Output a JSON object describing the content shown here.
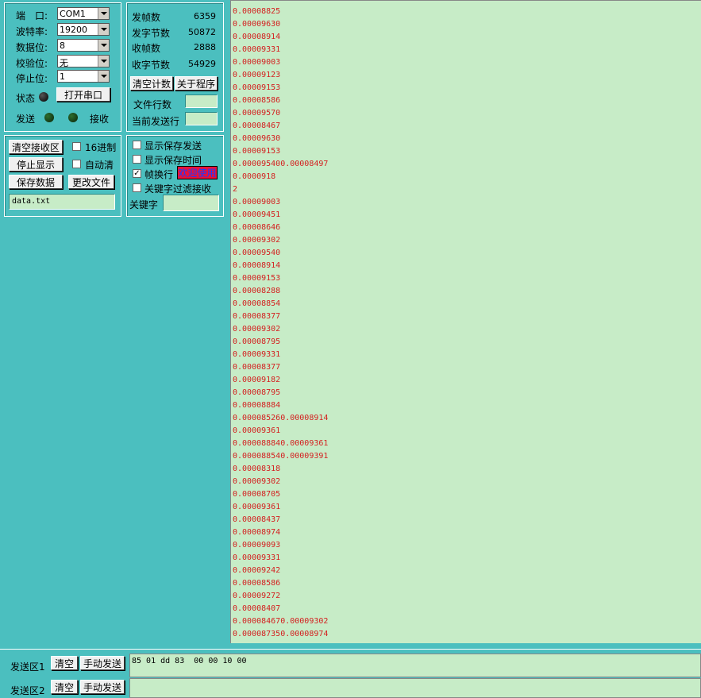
{
  "port_panel": {
    "port_label": "端　口:",
    "port_value": "COM1",
    "baud_label": "波特率:",
    "baud_value": "19200",
    "databits_label": "数据位:",
    "databits_value": "8",
    "parity_label": "校验位:",
    "parity_value": "无",
    "stopbits_label": "停止位:",
    "stopbits_value": "1",
    "status_label": "状态",
    "open_button": "打开串口",
    "send_label": "发送",
    "recv_label": "接收"
  },
  "stats_panel": {
    "sent_frames_label": "发帧数",
    "sent_frames": "6359",
    "sent_bytes_label": "发字节数",
    "sent_bytes": "50872",
    "recv_frames_label": "收帧数",
    "recv_frames": "2888",
    "recv_bytes_label": "收字节数",
    "recv_bytes": "54929",
    "clear_count_button": "清空计数",
    "about_button": "关于程序",
    "file_lines_label": "文件行数",
    "current_line_label": "当前发送行"
  },
  "recv_controls": {
    "clear_recv_button": "清空接收区",
    "hex_label": "16进制",
    "stop_display_button": "停止显示",
    "auto_clear_label": "自动清",
    "save_data_button": "保存数据",
    "change_file_button": "更改文件",
    "filename": "data.txt"
  },
  "options_panel": {
    "show_saved_send_label": "显示保存发送",
    "show_saved_time_label": "显示保存时间",
    "frame_newline_label": "帧换行",
    "frame_newline_checked": "✓",
    "welcome_label": "欢迎使用",
    "keyword_filter_label": "关键字过滤接收",
    "keyword_label": "关键字"
  },
  "recv_lines": [
    "0.00008825",
    "0.00009630",
    "0.00008914",
    "0.00009331",
    "0.00009003",
    "0.00009123",
    "0.00009153",
    "0.00008586",
    "0.00009570",
    "0.00008467",
    "0.00009630",
    "0.00009153",
    "0.000095400.00008497",
    "0.0000918",
    "2",
    "0.00009003",
    "0.00009451",
    "0.00008646",
    "0.00009302",
    "0.00009540",
    "0.00008914",
    "0.00009153",
    "0.00008288",
    "0.00008854",
    "0.00008377",
    "0.00009302",
    "0.00008795",
    "0.00009331",
    "0.00008377",
    "0.00009182",
    "0.00008795",
    "0.00008884",
    "0.000085260.00008914",
    "0.00009361",
    "0.000088840.00009361",
    "0.000088540.00009391",
    "0.00008318",
    "0.00009302",
    "0.00008705",
    "0.00009361",
    "0.00008437",
    "0.00008974",
    "0.00009093",
    "0.00009331",
    "0.00009242",
    "0.00008586",
    "0.00009272",
    "0.00008407",
    "0.000084670.00009302",
    "0.000087350.00008974"
  ],
  "send_area": {
    "area1_label": "发送区1",
    "area1_clear": "清空",
    "area1_send": "手动发送",
    "area1_content": "85 01 dd 83  00 00 10 00",
    "area2_label": "发送区2",
    "area2_clear": "清空",
    "area2_send": "手动发送",
    "area2_content": ""
  },
  "colors": {
    "background": "#4bbfbf",
    "recv_bg": "#c7ecc7",
    "recv_text": "#d42020",
    "welcome_bg": "#e8103a",
    "welcome_text": "#1a3cff"
  }
}
